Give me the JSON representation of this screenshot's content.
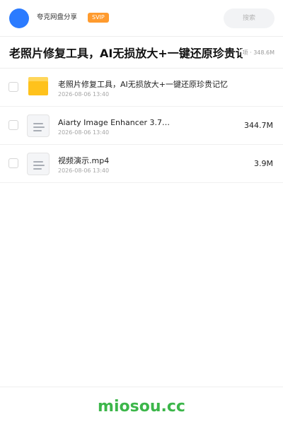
{
  "header": {
    "share_name": "夸克网盘分享",
    "badge": "SVIP",
    "search_placeholder": "搜索",
    "avatar_color": "#2b7bff"
  },
  "folder": {
    "title": "老照片修复工具，AI无损放大+一键还原珍贵记忆",
    "meta": "项 · 348.6M"
  },
  "files": [
    {
      "name": "老照片修复工具，AI无损放大+一键还原珍贵记忆",
      "date": "2026-08-06 13:40",
      "size": "",
      "icon": "folder-icon"
    },
    {
      "name": "Aiarty Image Enhancer 3.7…",
      "date": "2026-08-06 13:40",
      "size": "344.7M",
      "icon": "document-icon"
    },
    {
      "name": "视频演示.mp4",
      "date": "2026-08-06 13:40",
      "size": "3.9M",
      "icon": "document-icon"
    }
  ],
  "footer": {
    "brand": "miosou.cc",
    "brand_color": "#3cb64a"
  }
}
